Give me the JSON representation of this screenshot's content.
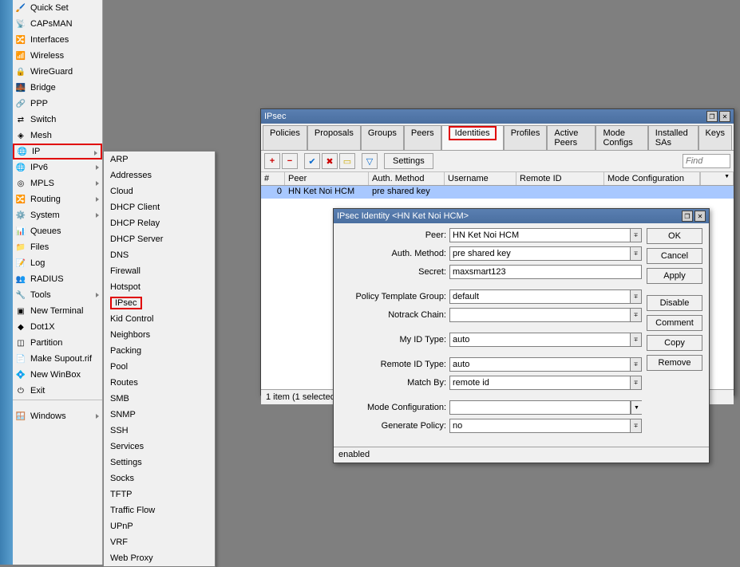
{
  "sidebar": {
    "items": [
      {
        "icon": "🖌️",
        "label": "Quick Set",
        "has_sub": false
      },
      {
        "icon": "📡",
        "label": "CAPsMAN",
        "has_sub": false
      },
      {
        "icon": "🔀",
        "label": "Interfaces",
        "has_sub": false
      },
      {
        "icon": "📶",
        "label": "Wireless",
        "has_sub": false
      },
      {
        "icon": "🔒",
        "label": "WireGuard",
        "has_sub": false
      },
      {
        "icon": "🌉",
        "label": "Bridge",
        "has_sub": false
      },
      {
        "icon": "🔗",
        "label": "PPP",
        "has_sub": false
      },
      {
        "icon": "⇄",
        "label": "Switch",
        "has_sub": false
      },
      {
        "icon": "◈",
        "label": "Mesh",
        "has_sub": false
      },
      {
        "icon": "🌐",
        "label": "IP",
        "has_sub": true,
        "hl": true
      },
      {
        "icon": "🌐",
        "label": "IPv6",
        "has_sub": true
      },
      {
        "icon": "◎",
        "label": "MPLS",
        "has_sub": true
      },
      {
        "icon": "🔀",
        "label": "Routing",
        "has_sub": true
      },
      {
        "icon": "⚙️",
        "label": "System",
        "has_sub": true
      },
      {
        "icon": "📊",
        "label": "Queues",
        "has_sub": false
      },
      {
        "icon": "📁",
        "label": "Files",
        "has_sub": false
      },
      {
        "icon": "📝",
        "label": "Log",
        "has_sub": false
      },
      {
        "icon": "👥",
        "label": "RADIUS",
        "has_sub": false
      },
      {
        "icon": "🔧",
        "label": "Tools",
        "has_sub": true
      },
      {
        "icon": "▣",
        "label": "New Terminal",
        "has_sub": false
      },
      {
        "icon": "◆",
        "label": "Dot1X",
        "has_sub": false
      },
      {
        "icon": "◫",
        "label": "Partition",
        "has_sub": false
      },
      {
        "icon": "📄",
        "label": "Make Supout.rif",
        "has_sub": false
      },
      {
        "icon": "💠",
        "label": "New WinBox",
        "has_sub": false
      },
      {
        "icon": "⏻",
        "label": "Exit",
        "has_sub": false
      }
    ],
    "windows_item": {
      "icon": "🪟",
      "label": "Windows",
      "has_sub": true
    }
  },
  "submenu": {
    "items": [
      "ARP",
      "Addresses",
      "Cloud",
      "DHCP Client",
      "DHCP Relay",
      "DHCP Server",
      "DNS",
      "Firewall",
      "Hotspot",
      "IPsec",
      "Kid Control",
      "Neighbors",
      "Packing",
      "Pool",
      "Routes",
      "SMB",
      "SNMP",
      "SSH",
      "Services",
      "Settings",
      "Socks",
      "TFTP",
      "Traffic Flow",
      "UPnP",
      "VRF",
      "Web Proxy"
    ],
    "highlighted": "IPsec"
  },
  "ipsec_window": {
    "title": "IPsec",
    "tabs": [
      "Policies",
      "Proposals",
      "Groups",
      "Peers",
      "Identities",
      "Profiles",
      "Active Peers",
      "Mode Configs",
      "Installed SAs",
      "Keys"
    ],
    "active_tab": "Identities",
    "toolbar": {
      "settings": "Settings",
      "find_placeholder": "Find"
    },
    "grid": {
      "headers": [
        "#",
        "Peer",
        "Auth. Method",
        "Username",
        "Remote ID",
        "Mode Configuration"
      ],
      "row": {
        "num": "0",
        "peer": "HN Ket Noi HCM",
        "auth": "pre shared key",
        "user": "",
        "remote": "",
        "mode": ""
      }
    },
    "status": "1 item (1 selected)"
  },
  "identity_window": {
    "title": "IPsec Identity <HN Ket Noi HCM>",
    "fields": {
      "peer_label": "Peer:",
      "peer_value": "HN Ket Noi HCM",
      "auth_label": "Auth. Method:",
      "auth_value": "pre shared key",
      "secret_label": "Secret:",
      "secret_value": "maxsmart123",
      "ptg_label": "Policy Template Group:",
      "ptg_value": "default",
      "notrack_label": "Notrack Chain:",
      "notrack_value": "",
      "myid_label": "My ID Type:",
      "myid_value": "auto",
      "remoteid_label": "Remote ID Type:",
      "remoteid_value": "auto",
      "match_label": "Match By:",
      "match_value": "remote id",
      "modecfg_label": "Mode Configuration:",
      "modecfg_value": "",
      "genpol_label": "Generate Policy:",
      "genpol_value": "no"
    },
    "buttons": {
      "ok": "OK",
      "cancel": "Cancel",
      "apply": "Apply",
      "disable": "Disable",
      "comment": "Comment",
      "copy": "Copy",
      "remove": "Remove"
    },
    "status": "enabled"
  }
}
